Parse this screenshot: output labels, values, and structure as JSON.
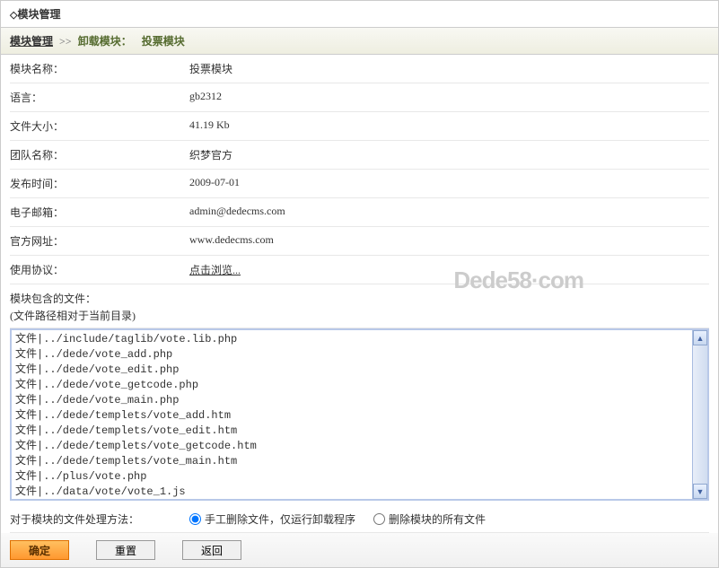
{
  "header": {
    "title": "模块管理"
  },
  "breadcrumb": {
    "root": "模块管理",
    "sep": ">>",
    "action": "卸载模块：",
    "target": "投票模块"
  },
  "fields": {
    "name": {
      "label": "模块名称：",
      "value": "投票模块"
    },
    "lang": {
      "label": "语言：",
      "value": "gb2312"
    },
    "size": {
      "label": "文件大小：",
      "value": "41.19 Kb"
    },
    "team": {
      "label": "团队名称：",
      "value": "织梦官方"
    },
    "date": {
      "label": "发布时间：",
      "value": "2009-07-01"
    },
    "email": {
      "label": "电子邮箱：",
      "value": "admin@dedecms.com"
    },
    "url": {
      "label": "官方网址：",
      "value": "www.dedecms.com"
    },
    "license": {
      "label": "使用协议：",
      "value": "点击浏览..."
    }
  },
  "filesec": {
    "title": "模块包含的文件：",
    "note": "(文件路径相对于当前目录)"
  },
  "files": [
    "文件|../include/taglib/vote.lib.php",
    "文件|../dede/vote_add.php",
    "文件|../dede/vote_edit.php",
    "文件|../dede/vote_getcode.php",
    "文件|../dede/vote_main.php",
    "文件|../dede/templets/vote_add.htm",
    "文件|../dede/templets/vote_edit.htm",
    "文件|../dede/templets/vote_getcode.htm",
    "文件|../dede/templets/vote_main.htm",
    "文件|../plus/vote.php",
    "文件|../data/vote/vote_1.js"
  ],
  "option": {
    "label": "对于模块的文件处理方法：",
    "opt1": "手工删除文件，仅运行卸载程序",
    "opt2": "删除模块的所有文件"
  },
  "buttons": {
    "ok": "确定",
    "reset": "重置",
    "back": "返回"
  },
  "watermark": "Dede58·com"
}
